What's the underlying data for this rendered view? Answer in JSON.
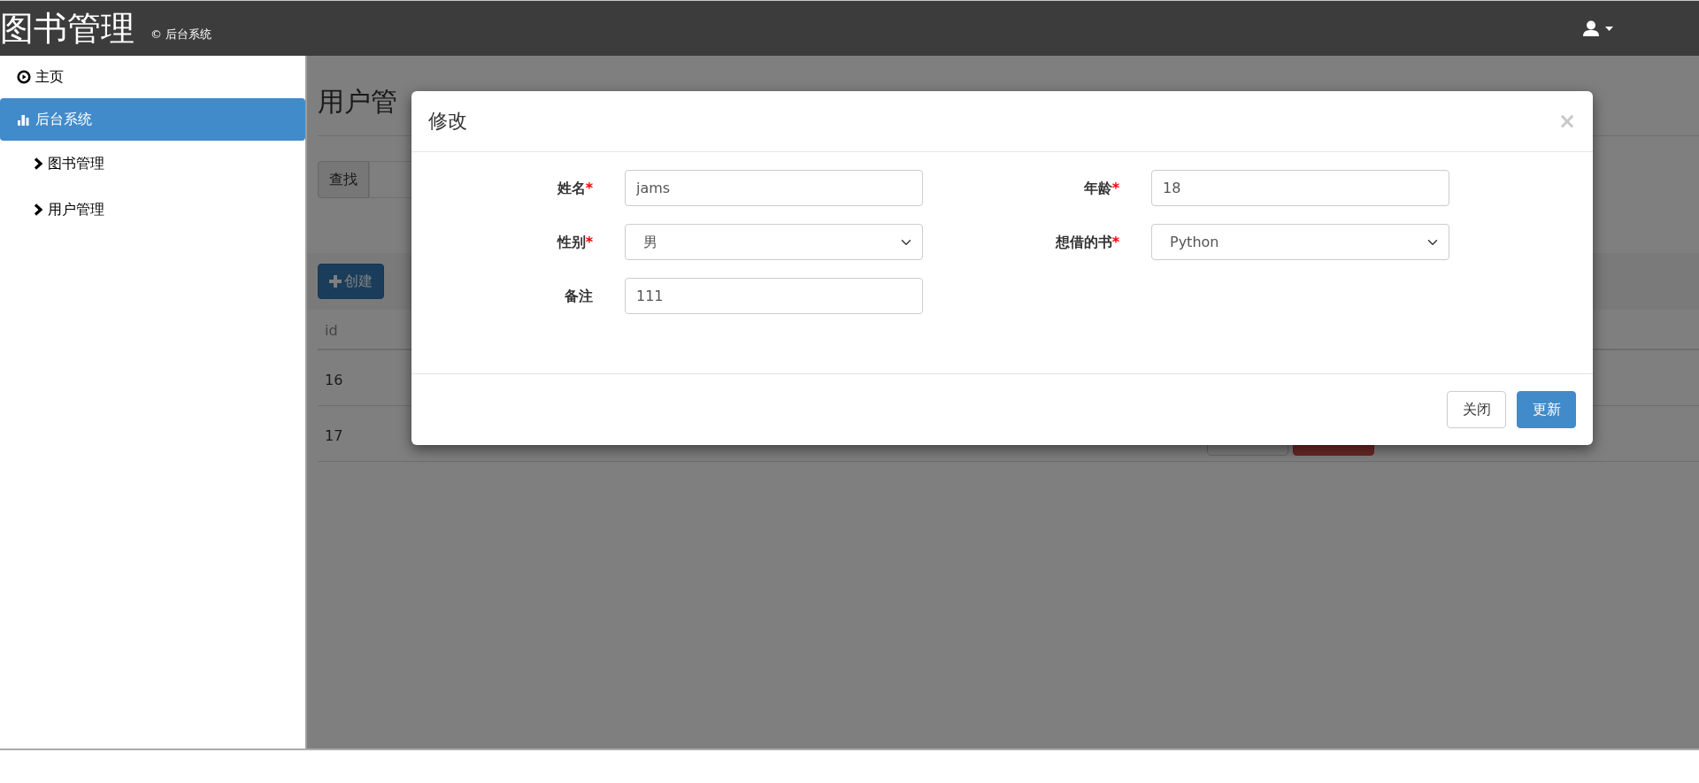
{
  "header": {
    "title": "图书管理",
    "subtitle": "© 后台系统"
  },
  "sidebar": {
    "items": [
      {
        "label": "主页",
        "selected": false
      },
      {
        "label": "后台系统",
        "selected": true,
        "children": [
          {
            "label": "图书管理",
            "selected": false
          },
          {
            "label": "用户管理",
            "selected": false
          }
        ]
      }
    ]
  },
  "page": {
    "title": "用户管",
    "search_addon": "查找",
    "create_button": "创建",
    "table": {
      "columns": [
        "id"
      ],
      "rows": [
        {
          "id": "16"
        },
        {
          "id": "17",
          "buttons": [
            {
              "kind": "default"
            },
            {
              "kind": "danger"
            }
          ]
        }
      ]
    }
  },
  "modal": {
    "title": "修改",
    "close": "×",
    "fields": [
      {
        "label": "姓名",
        "required_mark": "*",
        "kind": "input",
        "value": "jams"
      },
      {
        "label": "年龄",
        "required_mark": "*",
        "kind": "input",
        "value": "18"
      },
      {
        "label": "性别",
        "required_mark": "*",
        "kind": "select",
        "value": "男"
      },
      {
        "label": "想借的书",
        "required_mark": "*",
        "kind": "select",
        "value": "Python"
      },
      {
        "label": "备注",
        "kind": "input",
        "value": "111"
      }
    ],
    "buttons": [
      {
        "label": "关闭",
        "kind": "default"
      },
      {
        "label": "更新",
        "kind": "primary"
      }
    ]
  }
}
